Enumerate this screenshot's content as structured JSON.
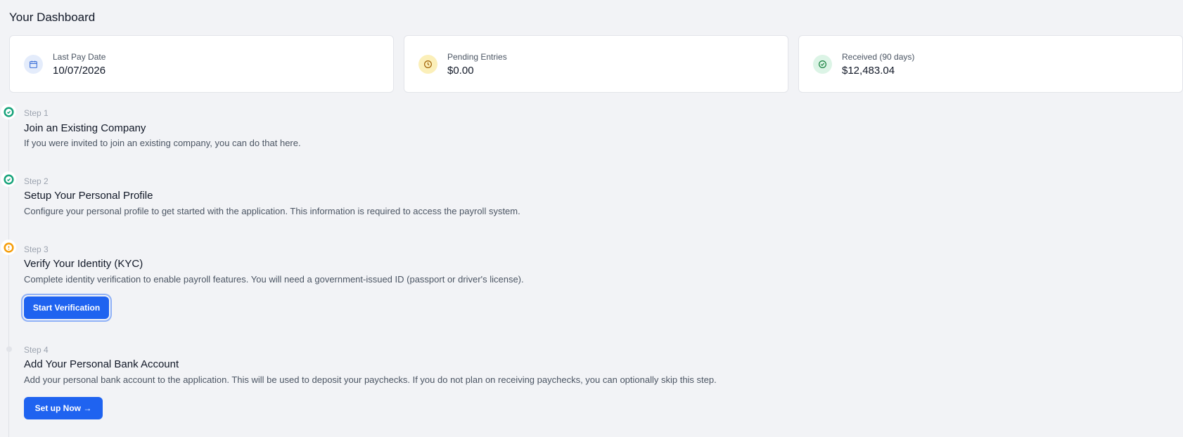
{
  "page": {
    "title": "Your Dashboard"
  },
  "cards": [
    {
      "label": "Last Pay Date",
      "value": "10/07/2026",
      "icon": "calendar-icon",
      "icon_bg": "#e4ecfb",
      "icon_color": "#3b6fd8"
    },
    {
      "label": "Pending Entries",
      "value": "$0.00",
      "icon": "clock-icon",
      "icon_bg": "#fbefb9",
      "icon_color": "#a16207"
    },
    {
      "label": "Received (90 days)",
      "value": "$12,483.04",
      "icon": "check-circle-icon",
      "icon_bg": "#dcf4e6",
      "icon_color": "#15803d"
    }
  ],
  "steps": [
    {
      "number": "Step 1",
      "title": "Join an Existing Company",
      "description": "If you were invited to join an existing company, you can do that here.",
      "status": "complete",
      "icon": "check-circle-icon"
    },
    {
      "number": "Step 2",
      "title": "Setup Your Personal Profile",
      "description": "Configure your personal profile to get started with the application. This information is required to access the payroll system.",
      "status": "complete",
      "icon": "check-circle-icon"
    },
    {
      "number": "Step 3",
      "title": "Verify Your Identity (KYC)",
      "description": "Complete identity verification to enable payroll features. You will need a government-issued ID (passport or driver's license).",
      "status": "warning",
      "icon": "alert-circle-icon",
      "button": "Start Verification"
    },
    {
      "number": "Step 4",
      "title": "Add Your Personal Bank Account",
      "description": "Add your personal bank account to the application. This will be used to deposit your paychecks. If you do not plan on receiving paychecks, you can optionally skip this step.",
      "status": "pending",
      "icon": "pending-dot-icon",
      "button": "Set up Now →"
    }
  ],
  "colors": {
    "accent": "#1f63f0",
    "success": "#16a34a",
    "warning": "#f59e0b",
    "background": "#f2f3f6"
  }
}
